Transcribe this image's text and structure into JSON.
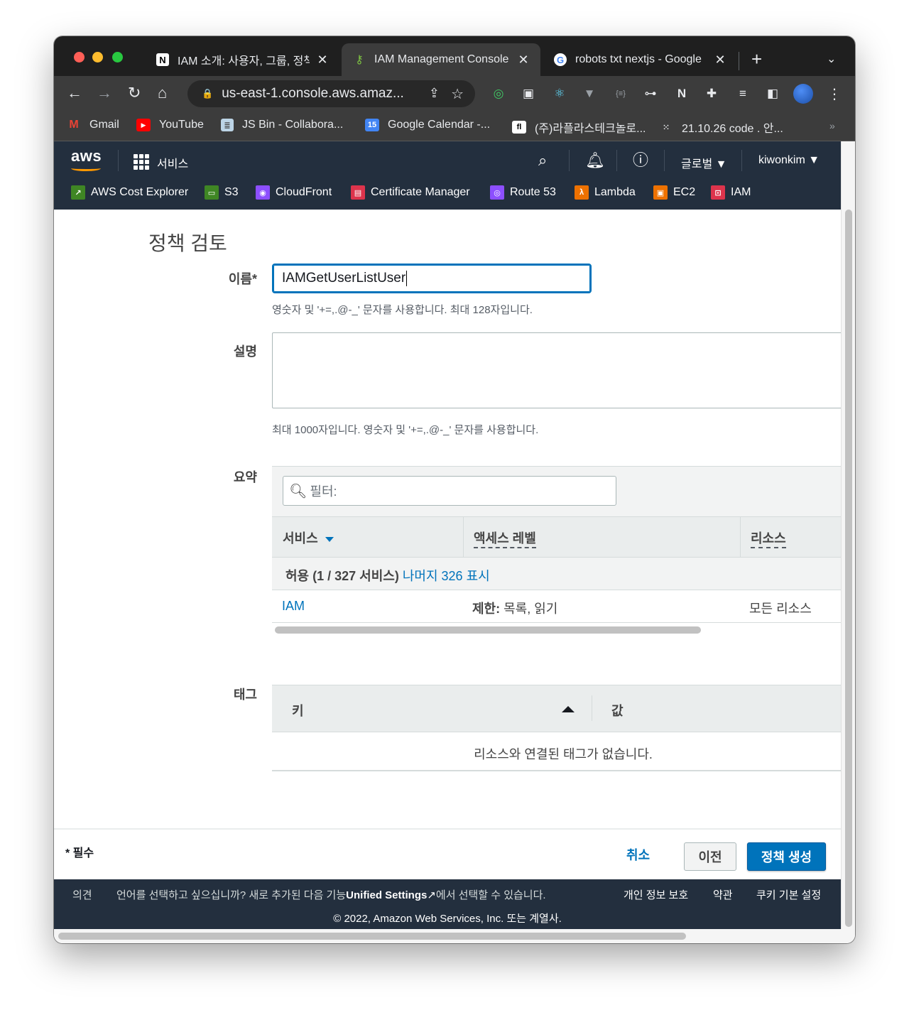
{
  "browser": {
    "tabs": [
      {
        "title": "IAM 소개: 사용자, 그룹, 정책",
        "icon": "notion-icon"
      },
      {
        "title": "IAM Management Console",
        "icon": "aws-key-icon"
      },
      {
        "title": "robots txt nextjs - Google",
        "icon": "google-icon"
      }
    ],
    "url": "us-east-1.console.aws.amaz...",
    "bookmarks": [
      {
        "label": "Gmail"
      },
      {
        "label": "YouTube"
      },
      {
        "label": "JS Bin - Collabora..."
      },
      {
        "label": "Google Calendar -..."
      },
      {
        "label": "(주)라플라스테크놀로..."
      },
      {
        "label": "21.10.26 code . 안..."
      }
    ]
  },
  "aws": {
    "logo": "aws",
    "services_label": "서비스",
    "region": "글로벌",
    "user": "kiwonkim",
    "favorites": [
      {
        "label": "AWS Cost Explorer",
        "color": "#3f8624"
      },
      {
        "label": "S3",
        "color": "#3f8624"
      },
      {
        "label": "CloudFront",
        "color": "#8c4fff"
      },
      {
        "label": "Certificate Manager",
        "color": "#dd344c"
      },
      {
        "label": "Route 53",
        "color": "#8c4fff"
      },
      {
        "label": "Lambda",
        "color": "#ed7100"
      },
      {
        "label": "EC2",
        "color": "#ed7100"
      },
      {
        "label": "IAM",
        "color": "#dd344c"
      }
    ]
  },
  "page": {
    "title": "정책 검토",
    "name_label": "이름*",
    "name_value": "IAMGetUserListUser",
    "name_hint": "영숫자 및 '+=,.@-_' 문자를 사용합니다. 최대 128자입니다.",
    "desc_label": "설명",
    "desc_hint": "최대 1000자입니다. 영숫자 및 '+=,.@-_' 문자를 사용합니다.",
    "summary_label": "요약",
    "filter_placeholder": "필터:",
    "columns": [
      "서비스",
      "액세스 레벨",
      "리소스"
    ],
    "allow_prefix": "허용 (1 / 327 서비스)",
    "allow_link": "나머지 326 표시",
    "rows": [
      {
        "service": "IAM",
        "access_bold": "제한:",
        "access": " 목록, 읽기",
        "resource": "모든 리소스"
      }
    ],
    "tags_label": "태그",
    "tags_columns": [
      "키",
      "값"
    ],
    "tags_empty": "리소스와 연결된 태그가 없습니다."
  },
  "actions": {
    "required": "* 필수",
    "cancel": "취소",
    "previous": "이전",
    "create": "정책 생성"
  },
  "footer": {
    "feedback": "의견",
    "lang_text": "언어를 선택하고 싶으십니까? 새로 추가된 다음 기능",
    "lang_bold": "Unified Settings",
    "lang_suffix": "에서 선택할 수 있습니다.",
    "privacy": "개인 정보 보호",
    "terms": "약관",
    "cookies": "쿠키 기본 설정",
    "copyright": "© 2022, Amazon Web Services, Inc. 또는 계열사."
  }
}
